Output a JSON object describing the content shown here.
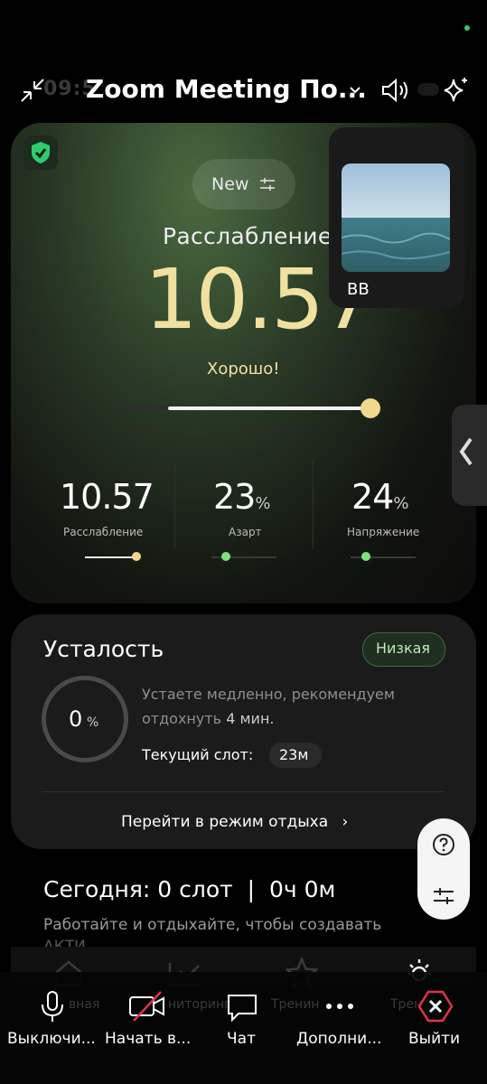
{
  "zoom": {
    "title": "Zoom Meeting По...",
    "ghost_time": "09:5",
    "participant_name": "BB",
    "toolbar": [
      {
        "label": "Выключи...",
        "icon": "microphone-icon"
      },
      {
        "label": "Начать в...",
        "icon": "video-off-icon"
      },
      {
        "label": "Чат",
        "icon": "chat-icon"
      },
      {
        "label": "Дополни...",
        "icon": "more-icon"
      },
      {
        "label": "Выйти",
        "icon": "leave-icon"
      }
    ]
  },
  "relax": {
    "mode_label": "New",
    "title": "Расслабление",
    "value": "10.57",
    "rating": "Хорошо!",
    "slider_level": 0.8,
    "stats": [
      {
        "value": "10.57",
        "unit": "",
        "label": "Расслабление"
      },
      {
        "value": "23",
        "unit": "%",
        "label": "Азарт"
      },
      {
        "value": "24",
        "unit": "%",
        "label": "Напряжение"
      }
    ]
  },
  "fatigue": {
    "title": "Усталость",
    "badge": "Низкая",
    "percent": "0",
    "percent_unit": "%",
    "description_1": "Устаете медленно, рекомендуем",
    "description_2a": "отдохнуть",
    "description_2b": "4 мин.",
    "slot_label": "Текущий слот:",
    "slot_value": "23м",
    "rest_link": "Перейти в режим отдыха"
  },
  "today": {
    "title": "Сегодня: 0 слот  |  0ч 0м",
    "description": "Работайте и отдыхайте, чтобы создавать",
    "description_cut": "АКТИ"
  },
  "app_nav": [
    "вная",
    "ниторинг",
    "Тренин",
    "Трен"
  ],
  "colors": {
    "accent_gold": "#f0e1a1",
    "accent_green": "#7ee07e",
    "leave_red": "#e0334a"
  }
}
